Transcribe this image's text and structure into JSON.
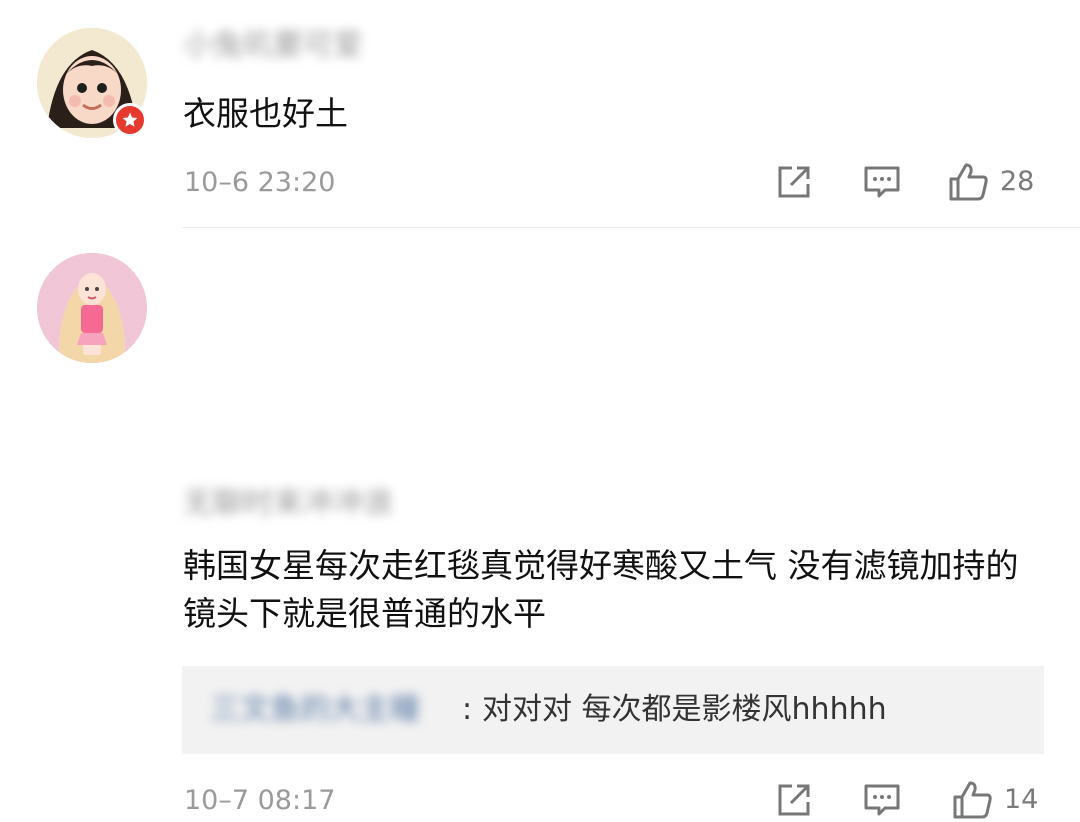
{
  "comments": [
    {
      "username": "小兔叽要可爱",
      "text": "衣服也好土",
      "timestamp": "10–6 23:20",
      "likes": "28",
      "avatar": "avatar-icon",
      "badge": "verified-star-icon"
    },
    {
      "username": "无聊时来冲冲浪",
      "text": "韩国女星每次走红毯真觉得好寒酸又土气  没有滤镜加持的镜头下就是很普通的水平",
      "timestamp": "10–7 08:17",
      "likes": "14",
      "avatar": "avatar-icon",
      "reply": {
        "author": "三文鱼的大主瞳",
        "separator": ":",
        "text": "对对对 每次都是影楼风hhhhh"
      }
    }
  ],
  "icons": {
    "share": "share-icon",
    "reply": "comment-icon",
    "like": "thumbs-up-icon"
  },
  "colors": {
    "background": "#ffffff",
    "text_primary": "#111111",
    "text_secondary": "#9a9a9a",
    "reply_background": "#f2f2f2",
    "badge": "#e73a2f"
  }
}
